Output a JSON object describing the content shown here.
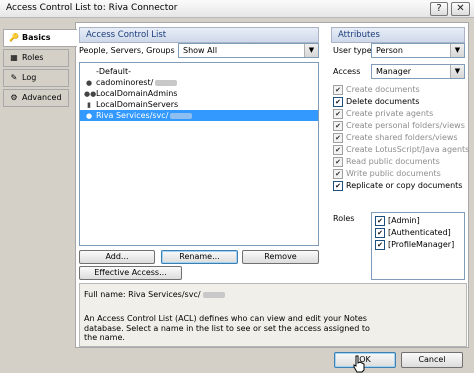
{
  "window": {
    "title": "Access Control List to: Riva Connector",
    "help_btn": "?",
    "close_btn": "✕"
  },
  "nav": [
    {
      "label": "Basics",
      "icon": "key-icon",
      "glyph": "🔑"
    },
    {
      "label": "Roles",
      "icon": "roles-icon",
      "glyph": "▦"
    },
    {
      "label": "Log",
      "icon": "log-icon",
      "glyph": "✎"
    },
    {
      "label": "Advanced",
      "icon": "advanced-icon",
      "glyph": "⚙"
    }
  ],
  "acl": {
    "header": "Access Control List",
    "filter_label": "People, Servers, Groups",
    "filter_value": "Show All",
    "entries": [
      {
        "name": "-Default-",
        "icon": ""
      },
      {
        "name": "cadominorest/",
        "icon": "person"
      },
      {
        "name": "LocalDomainAdmins",
        "icon": "group"
      },
      {
        "name": "LocalDomainServers",
        "icon": "server"
      },
      {
        "name": "Riva Services/svc/",
        "icon": "person",
        "selected": true
      }
    ],
    "add_btn": "Add...",
    "rename_btn": "Rename...",
    "remove_btn": "Remove",
    "effective_btn": "Effective Access...",
    "fullname_label": "Full name: Riva Services/svc/",
    "description": "An Access Control List (ACL) defines who can view and edit your Notes database.  Select a name in the list to see or set the access assigned to the name."
  },
  "attributes": {
    "header": "Attributes",
    "user_type_label": "User type",
    "user_type_value": "Person",
    "access_label": "Access",
    "access_value": "Manager",
    "checks": [
      {
        "label": "Create documents",
        "checked": true,
        "enabled": false
      },
      {
        "label": "Delete documents",
        "checked": true,
        "enabled": true
      },
      {
        "label": "Create private agents",
        "checked": true,
        "enabled": false
      },
      {
        "label": "Create personal folders/views",
        "checked": true,
        "enabled": false
      },
      {
        "label": "Create shared folders/views",
        "checked": true,
        "enabled": false
      },
      {
        "label": "Create LotusScript/Java agents",
        "checked": true,
        "enabled": false
      },
      {
        "label": "Read public documents",
        "checked": true,
        "enabled": false
      },
      {
        "label": "Write public documents",
        "checked": true,
        "enabled": false
      },
      {
        "label": "Replicate or copy documents",
        "checked": true,
        "enabled": true
      }
    ],
    "roles_label": "Roles",
    "roles": [
      {
        "label": "[Admin]",
        "checked": true
      },
      {
        "label": "[Authenticated]",
        "checked": true
      },
      {
        "label": "[ProfileManager]",
        "checked": true
      }
    ]
  },
  "footer": {
    "ok_btn": "OK",
    "cancel_btn": "Cancel"
  }
}
